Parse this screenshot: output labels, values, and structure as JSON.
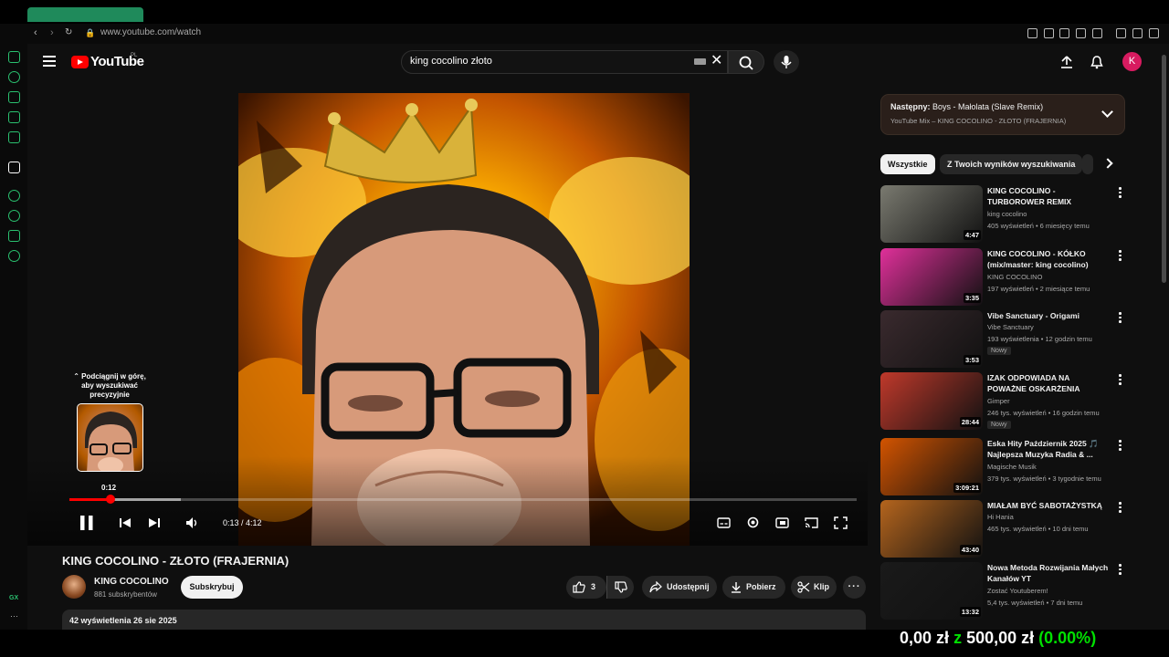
{
  "browser": {
    "address": "www.youtube.com/watch"
  },
  "header": {
    "logo_text": "YouTube",
    "logo_region": "PL",
    "search_value": "king cocolino złoto",
    "avatar_letter": "K"
  },
  "player": {
    "seek_hint": "⌃ Podciągnij w górę, aby wyszukiwać precyzyjnie",
    "seek_time": "0:12",
    "time_display": "0:13 / 4:12",
    "progress_fraction": 0.052
  },
  "video": {
    "title": "KING COCOLINO - ZŁOTO (FRAJERNIA)",
    "channel": "KING COCOLINO",
    "subscribers": "881 subskrybentów",
    "subscribe_label": "Subskrybuj",
    "likes": "3",
    "share_label": "Udostępnij",
    "download_label": "Pobierz",
    "clip_label": "Klip",
    "views_date": "42 wyświetlenia  26 sie 2025"
  },
  "next_up": {
    "label": "Następny:",
    "title": "Boys - Małolata (Slave Remix)",
    "subtitle": "YouTube Mix – KING COCOLINO - ZŁOTO (FRAJERNIA)"
  },
  "chips": [
    "Wszystkie",
    "Z Twoich wyników wyszukiwania"
  ],
  "recommendations": [
    {
      "title": "KING COCOLINO - TURBOROWER REMIX",
      "channel": "king cocolino",
      "meta": "405 wyświetleń • 6 miesięcy temu",
      "duration": "4:47",
      "badge": "",
      "color": "#7a7a70"
    },
    {
      "title": "KING COCOLINO - KÓŁKO (mix/master: king cocolino)",
      "channel": "KING COCOLINO",
      "meta": "197 wyświetleń • 2 miesiące temu",
      "duration": "3:35",
      "badge": "",
      "color": "#e0309a"
    },
    {
      "title": "Vibe Sanctuary - Origami",
      "channel": "Vibe Sanctuary",
      "meta": "193 wyświetlenia • 12 godzin temu",
      "duration": "3:53",
      "badge": "Nowy",
      "color": "#3a2a2e"
    },
    {
      "title": "IZAK ODPOWIADA NA POWAŻNE OSKARŻENIA",
      "channel": "Gimper",
      "meta": "246 tys. wyświetleń • 16 godzin temu",
      "duration": "28:44",
      "badge": "Nowy",
      "color": "#c0392b"
    },
    {
      "title": "Eska Hity Październik 2025 🎵 Najlepsza Muzyka Radia & ...",
      "channel": "Magische Musik",
      "meta": "379 tys. wyświetleń • 3 tygodnie temu",
      "duration": "3:09:21",
      "badge": "",
      "color": "#d35400"
    },
    {
      "title": "MIAŁAM BYĆ SABOTAŻYSTKĄ",
      "channel": "Hi Hania",
      "meta": "465 tys. wyświetleń • 10 dni temu",
      "duration": "43:40",
      "badge": "",
      "color": "#b5651d"
    },
    {
      "title": "Nowa Metoda Rozwijania Małych Kanałów YT",
      "channel": "Zostać Youtuberem!",
      "meta": "5,4 tys. wyświetleń • 7 dni temu",
      "duration": "13:32",
      "badge": "",
      "color": "#1a1a1a"
    }
  ],
  "overlay": {
    "amount": "0,00 zł",
    "of": "z",
    "goal": "500,00 zł",
    "percent": "(0.00%)"
  },
  "colors": {
    "accent": "#ff0000",
    "browser_accent": "#2ac06f",
    "avatar": "#d81b60",
    "overlay_green": "#00e000"
  }
}
